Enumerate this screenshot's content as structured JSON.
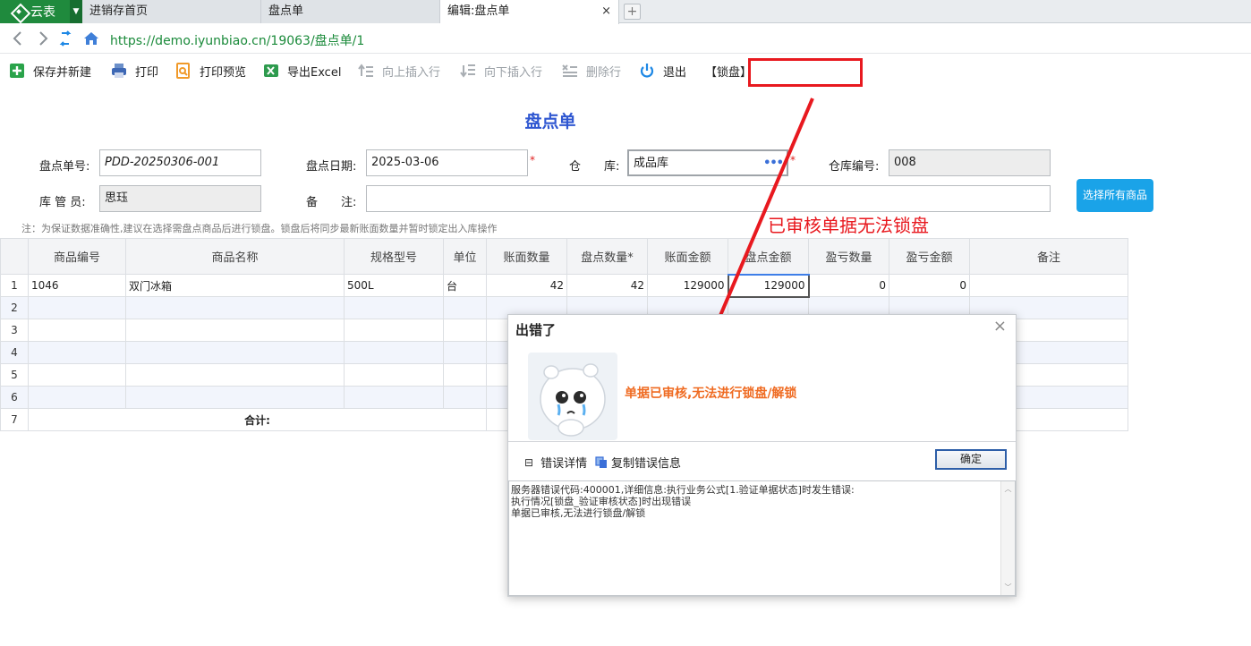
{
  "tabs": {
    "brand": "云表",
    "items": [
      {
        "label": "进销存首页"
      },
      {
        "label": "盘点单"
      },
      {
        "label": "编辑:盘点单"
      }
    ],
    "close_glyph": "×",
    "add_glyph": "+"
  },
  "address": {
    "url": "https://demo.iyunbiao.cn/19063/盘点单/1"
  },
  "toolbar": {
    "save_new": "保存并新建",
    "print": "打印",
    "print_preview": "打印预览",
    "export_excel": "导出Excel",
    "insert_above": "向上插入行",
    "insert_below": "向下插入行",
    "delete_row": "删除行",
    "exit": "退出",
    "lock": "【锁盘】"
  },
  "form": {
    "title": "盘点单",
    "number_label": "盘点单号:",
    "number_value": "PDD-20250306-001",
    "date_label": "盘点日期:",
    "date_value": "2025-03-06",
    "warehouse_label": "仓　　库:",
    "warehouse_value": "成品库",
    "warehouse_code_label": "仓库编号:",
    "warehouse_code_value": "008",
    "keeper_label": "库 管 员:",
    "keeper_value": "思珏",
    "remark_label": "备　　注:",
    "remark_value": "",
    "required_mark": "*",
    "select_all_button": "选择所有商品",
    "note": "注：为保证数据准确性,建议在选择需盘点商品后进行锁盘。锁盘后将同步最新账面数量并暂时锁定出入库操作"
  },
  "annotation": "已审核单据无法锁盘",
  "grid": {
    "headers": [
      "",
      "商品编号",
      "商品名称",
      "规格型号",
      "单位",
      "账面数量",
      "盘点数量*",
      "账面金额",
      "盘点金额",
      "盈亏数量",
      "盈亏金额",
      "备注"
    ],
    "rows": [
      [
        "1",
        "1046",
        "双门冰箱",
        "500L",
        "台",
        "42",
        "42",
        "129000",
        "129000",
        "0",
        "0",
        ""
      ],
      [
        "2",
        "",
        "",
        "",
        "",
        "",
        "",
        "",
        "",
        "",
        "",
        ""
      ],
      [
        "3",
        "",
        "",
        "",
        "",
        "",
        "",
        "",
        "",
        "",
        "",
        ""
      ],
      [
        "4",
        "",
        "",
        "",
        "",
        "",
        "",
        "",
        "",
        "",
        "",
        ""
      ],
      [
        "5",
        "",
        "",
        "",
        "",
        "",
        "",
        "",
        "",
        "",
        "",
        ""
      ],
      [
        "6",
        "",
        "",
        "",
        "",
        "",
        "",
        "",
        "",
        "",
        "",
        ""
      ]
    ],
    "total_row": {
      "index": "7",
      "label": "合计:"
    }
  },
  "dialog": {
    "title": "出错了",
    "close_glyph": "×",
    "message": "单据已审核,无法进行锁盘/解锁",
    "details_toggle": "⊟",
    "details_label": "错误详情",
    "copy_label": "复制错误信息",
    "ok_button": "确定",
    "log_lines": [
      "服务器错误代码:400001,详细信息:执行业务公式[1.验证单据状态]时发生错误:",
      "执行情况[锁盘_验证审核状态]时出现错误",
      "单据已审核,无法进行锁盘/解锁"
    ]
  },
  "colors": {
    "brand_green": "#1f8a3d",
    "title_blue": "#2f57d1",
    "annotation_red": "#e8191f",
    "message_orange": "#ef6b22",
    "button_blue": "#1aa3e8"
  }
}
